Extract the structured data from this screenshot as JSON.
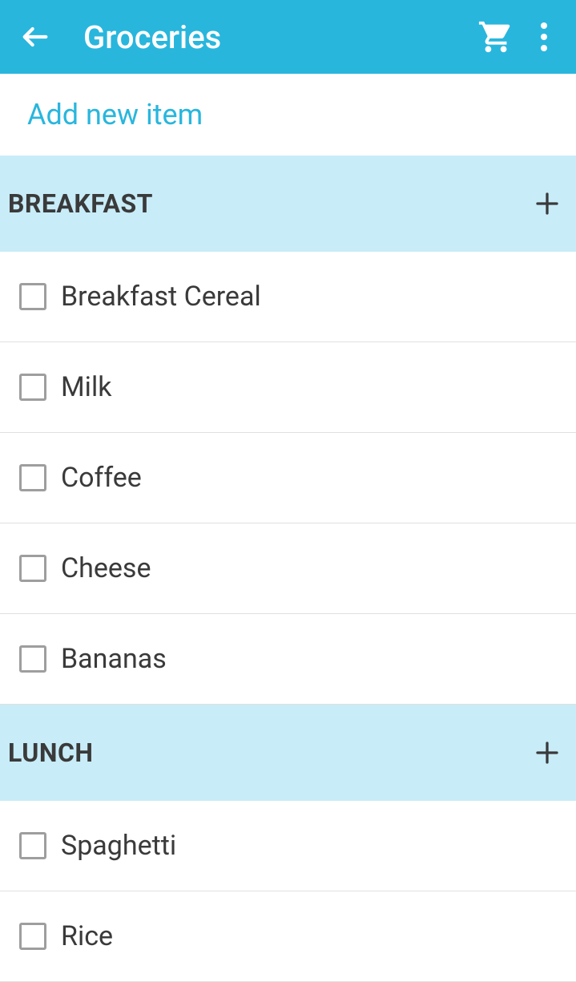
{
  "header": {
    "title": "Groceries"
  },
  "add_new_item_label": "Add new item",
  "sections": [
    {
      "title": "BREAKFAST",
      "items": [
        {
          "label": "Breakfast Cereal"
        },
        {
          "label": "Milk"
        },
        {
          "label": "Coffee"
        },
        {
          "label": "Cheese"
        },
        {
          "label": "Bananas"
        }
      ]
    },
    {
      "title": "LUNCH",
      "items": [
        {
          "label": "Spaghetti"
        },
        {
          "label": "Rice"
        }
      ]
    }
  ]
}
